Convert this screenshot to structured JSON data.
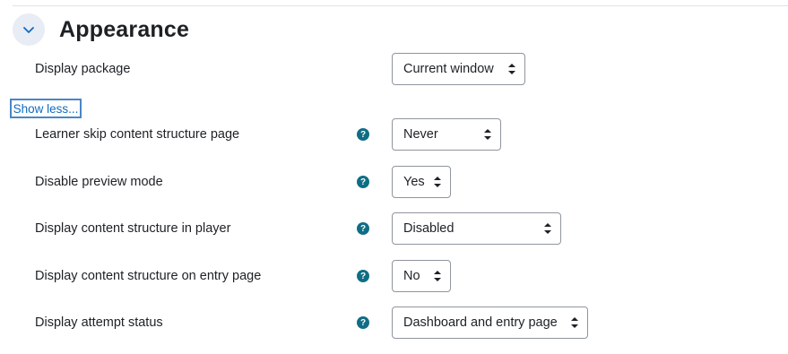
{
  "section": {
    "title": "Appearance",
    "collapse_icon": "chevron-down-icon"
  },
  "display_package": {
    "label": "Display package",
    "value": "Current window"
  },
  "show_less": {
    "label": "Show less..."
  },
  "settings": [
    {
      "label": "Learner skip content structure page",
      "value": "Never",
      "help": "?"
    },
    {
      "label": "Disable preview mode",
      "value": "Yes",
      "help": "?"
    },
    {
      "label": "Display content structure in player",
      "value": "Disabled",
      "help": "?"
    },
    {
      "label": "Display content structure on entry page",
      "value": "No",
      "help": "?"
    },
    {
      "label": "Display attempt status",
      "value": "Dashboard and entry page",
      "help": "?"
    }
  ],
  "colors": {
    "accent": "#0f6cbf",
    "help_icon": "#0f6e85",
    "collapse_bg": "#e7ecf5"
  }
}
